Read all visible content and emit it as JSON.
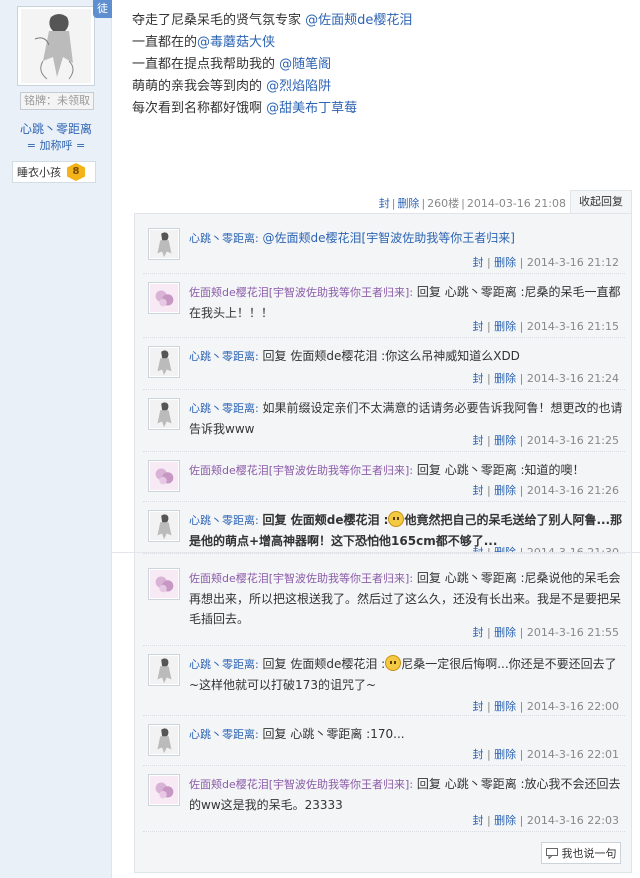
{
  "author": {
    "name": "心跳丶零距离",
    "follow": "= 加称呼 =",
    "medal": "铭牌：未领取",
    "badge": "徒",
    "level_title": "睡衣小孩",
    "level": "8"
  },
  "post": {
    "lines": [
      {
        "text": "夺走了尼桑呆毛的贤气氛专家 ",
        "mention": "@佐面颊de樱花泪"
      },
      {
        "text": "一直都在的",
        "mention": "@毒蘑菇大侠"
      },
      {
        "text": "一直都在提点我帮助我的 ",
        "mention": "@随笔阁"
      },
      {
        "text": "萌萌的亲我会等到肉的 ",
        "mention": "@烈焰陷阱"
      },
      {
        "text": "每次看到名称都好饿啊 ",
        "mention": "@甜美布丁草莓"
      }
    ],
    "meta": {
      "block": "封",
      "delete": "删除",
      "floor": "260楼",
      "time": "2014-03-16 21:08"
    },
    "collapse": "收起回复"
  },
  "replies": [
    {
      "user": "心跳丶零距离:",
      "text": "@佐面颊de樱花泪[宇智波佐助我等你王者归来]",
      "time": "2014-3-16 21:12"
    },
    {
      "user": "佐面颊de樱花泪[宇智波佐助我等你王者归来]:",
      "text": "回复 心跳丶零距离 :尼桑的呆毛一直都在我头上！！！",
      "time": "2014-3-16 21:15"
    },
    {
      "user": "心跳丶零距离:",
      "text": "回复 佐面颊de樱花泪 :你这么吊神威知道么XDD",
      "time": "2014-3-16 21:24"
    },
    {
      "user": "心跳丶零距离:",
      "text": "如果前缀设定亲们不太满意的话请务必要告诉我阿鲁！想更改的也请告诉我www",
      "time": "2014-3-16 21:25"
    },
    {
      "user": "佐面颊de樱花泪[宇智波佐助我等你王者归来]:",
      "text": "回复 心跳丶零距离 :知道的噢！",
      "time": "2014-3-16 21:26"
    },
    {
      "user": "心跳丶零距离:",
      "text_a": "回复 佐面颊de樱花泪 :",
      "text_b": "他竟然把自己的呆毛送给了别人阿鲁...那是他的萌点+增高神器啊！这下恐怕他165cm都不够了...",
      "time": "2014-3-16 21:30"
    },
    {
      "user": "佐面颊de樱花泪[宇智波佐助我等你王者归来]:",
      "text": "回复 心跳丶零距离 :尼桑说他的呆毛会再想出来，所以把这根送我了。然后过了这么久，还没有长出来。我是不是要把呆毛插回去。",
      "time": "2014-3-16 21:55"
    },
    {
      "user": "心跳丶零距离:",
      "text_a": "回复 佐面颊de樱花泪 :",
      "text_b": "尼桑一定很后悔啊...你还是不要还回去了~这样他就可以打破173的诅咒了~",
      "time": "2014-3-16 22:00"
    },
    {
      "user": "心跳丶零距离:",
      "text": "回复 心跳丶零距离 :170...",
      "time": "2014-3-16 22:01"
    },
    {
      "user": "佐面颊de樱花泪[宇智波佐助我等你王者归来]:",
      "text": "回复 心跳丶零距离 :放心我不会还回去的ww这是我的呆毛。23333",
      "time": "2014-3-16 22:03"
    }
  ],
  "actions": {
    "block": "封",
    "delete": "删除",
    "me_too": "我也说一句"
  }
}
